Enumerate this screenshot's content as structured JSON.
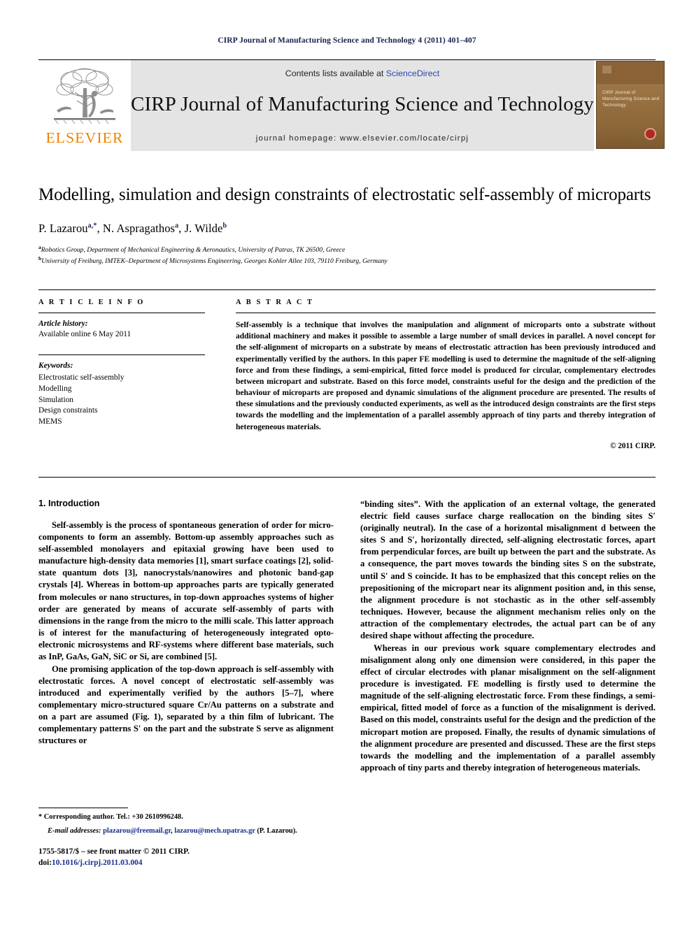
{
  "running_head": "CIRP Journal of Manufacturing Science and Technology 4 (2011) 401–407",
  "masthead": {
    "publisher_name": "ELSEVIER",
    "contents_prefix": "Contents lists available at ",
    "contents_link": "ScienceDirect",
    "journal_title": "CIRP Journal of Manufacturing Science and Technology",
    "homepage": "journal homepage: www.elsevier.com/locate/cirpj",
    "cover_title": "CIRP Journal of Manufacturing Science and Technology"
  },
  "article": {
    "title": "Modelling, simulation and design constraints of electrostatic self-assembly of microparts",
    "authors": "P. Lazarou, N. Aspragathos, J. Wilde",
    "author_list": [
      {
        "name": "P. Lazarou",
        "marks": "a,*"
      },
      {
        "name": "N. Aspragathos",
        "marks": "a"
      },
      {
        "name": "J. Wilde",
        "marks": "b"
      }
    ],
    "affiliations": [
      {
        "mark": "a",
        "text": "Robotics Group, Department of Mechanical Engineering & Aeronautics, University of Patras, TK 26500, Greece"
      },
      {
        "mark": "b",
        "text": "University of Freiburg, IMTEK–Department of Microsystems Engineering, Georges Kohler Allee 103, 79110 Freiburg, Germany"
      }
    ]
  },
  "article_info": {
    "heading": "A R T I C L E  I N F O",
    "history_label": "Article history:",
    "history_value": "Available online 6 May 2011",
    "keywords_label": "Keywords:",
    "keywords": [
      "Electrostatic self-assembly",
      "Modelling",
      "Simulation",
      "Design constraints",
      "MEMS"
    ]
  },
  "abstract": {
    "heading": "A B S T R A C T",
    "text": "Self-assembly is a technique that involves the manipulation and alignment of microparts onto a substrate without additional machinery and makes it possible to assemble a large number of small devices in parallel. A novel concept for the self-alignment of microparts on a substrate by means of electrostatic attraction has been previously introduced and experimentally verified by the authors. In this paper FE modelling is used to determine the magnitude of the self-aligning force and from these findings, a semi-empirical, fitted force model is produced for circular, complementary electrodes between micropart and substrate. Based on this force model, constraints useful for the design and the prediction of the behaviour of microparts are proposed and dynamic simulations of the alignment procedure are presented. The results of these simulations and the previously conducted experiments, as well as the introduced design constraints are the first steps towards the modelling and the implementation of a parallel assembly approach of tiny parts and thereby integration of heterogeneous materials.",
    "copyright": "© 2011 CIRP."
  },
  "introduction": {
    "section_title": "1. Introduction",
    "left_paragraphs": [
      "Self-assembly is the process of spontaneous generation of order for micro-components to form an assembly. Bottom-up assembly approaches such as self-assembled monolayers and epitaxial growing have been used to manufacture high-density data memories [1], smart surface coatings [2], solid-state quantum dots [3], nanocrystals/nanowires and photonic band-gap crystals [4]. Whereas in bottom-up approaches parts are typically generated from molecules or nano structures, in top-down approaches systems of higher order are generated by means of accurate self-assembly of parts with dimensions in the range from the micro to the milli scale. This latter approach is of interest for the manufacturing of heterogeneously integrated opto-electronic microsystems and RF-systems where different base materials, such as InP, GaAs, GaN, SiC or Si, are combined [5].",
      "One promising application of the top-down approach is self-assembly with electrostatic forces. A novel concept of electrostatic self-assembly was introduced and experimentally verified by the authors [5–7], where complementary micro-structured square Cr/Au patterns on a substrate and on a part are assumed (Fig. 1), separated by a thin film of lubricant. The complementary patterns S′ on the part and the substrate S serve as alignment structures or"
    ],
    "right_paragraphs": [
      "“binding sites”. With the application of an external voltage, the generated electric field causes surface charge reallocation on the binding sites S′ (originally neutral). In the case of a horizontal misalignment d between the sites S and S′, horizontally directed, self-aligning electrostatic forces, apart from perpendicular forces, are built up between the part and the substrate. As a consequence, the part moves towards the binding sites S on the substrate, until S′ and S coincide. It has to be emphasized that this concept relies on the prepositioning of the micropart near its alignment position and, in this sense, the alignment procedure is not stochastic as in the other self-assembly techniques. However, because the alignment mechanism relies only on the attraction of the complementary electrodes, the actual part can be of any desired shape without affecting the procedure.",
      "Whereas in our previous work square complementary electrodes and misalignment along only one dimension were considered, in this paper the effect of circular electrodes with planar misalignment on the self-alignment procedure is investigated. FE modelling is firstly used to determine the magnitude of the self-aligning electrostatic force. From these findings, a semi-empirical, fitted model of force as a function of the misalignment is derived. Based on this model, constraints useful for the design and the prediction of the micropart motion are proposed. Finally, the results of dynamic simulations of the alignment procedure are presented and discussed. These are the first steps towards the modelling and the implementation of a parallel assembly approach of tiny parts and thereby integration of heterogeneous materials."
    ]
  },
  "footnote": {
    "corresponding": "Corresponding author. Tel.: +30 2610996248.",
    "email_label": "E-mail addresses:",
    "email_1": "plazarou@freemail.gr",
    "email_sep": ", ",
    "email_2": "lazarou@mech.upatras.gr",
    "email_suffix": " (P. Lazarou)."
  },
  "footer": {
    "front_matter": "1755-5817/$ – see front matter © 2011 CIRP.",
    "doi_label": "doi:",
    "doi_value": "10.1016/j.cirpj.2011.03.004"
  },
  "colors": {
    "link_blue": "#1b2e8c",
    "sciencedirect_blue": "#2b46b4",
    "elsevier_orange": "#f08000",
    "running_head_navy": "#18214d",
    "masthead_grey": "#e4e4e4",
    "cover_brown": "#8a6236"
  }
}
